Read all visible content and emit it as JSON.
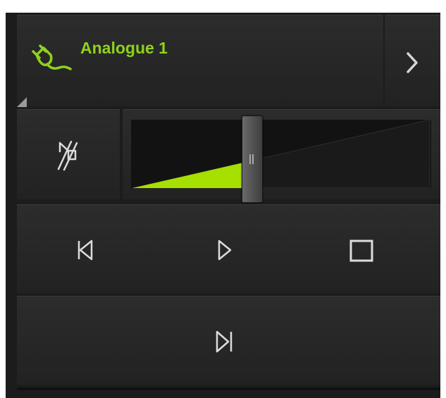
{
  "source": {
    "title": "Analogue 1",
    "icon": "plug-icon",
    "next_icon": "chevron-right-icon",
    "accent_color": "#8fd21c"
  },
  "volume": {
    "mute_icon": "speaker-muted-icon",
    "level": 0.4,
    "fill_color": "#a6e000"
  },
  "transport": {
    "previous_icon": "skip-previous-icon",
    "play_icon": "play-icon",
    "stop_icon": "stop-icon",
    "next_icon": "skip-next-icon"
  }
}
